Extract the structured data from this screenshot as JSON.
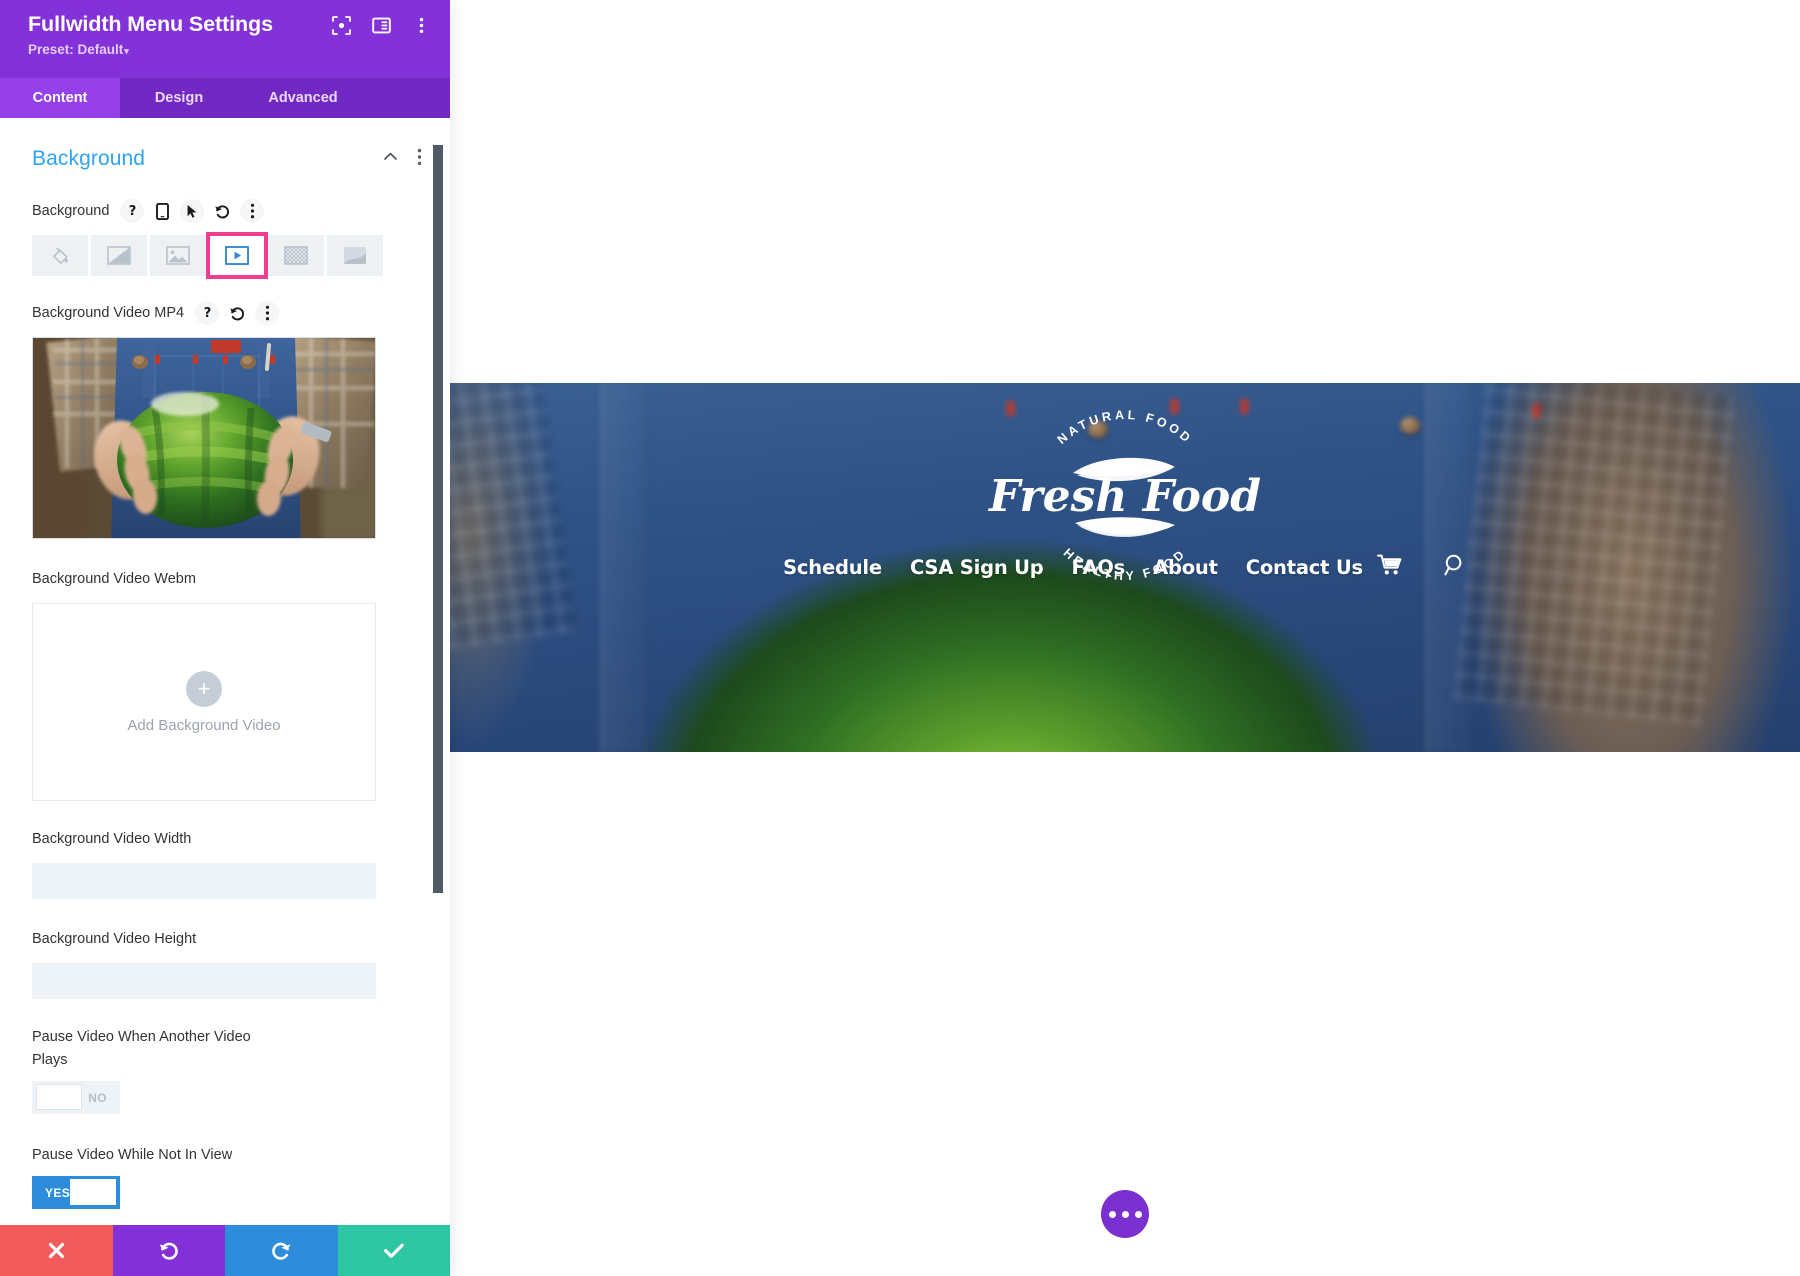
{
  "panel": {
    "title": "Fullwidth Menu Settings",
    "preset_label": "Preset: Default",
    "preset_caret": "▾",
    "header_icons": [
      {
        "name": "focus-icon"
      },
      {
        "name": "layout-toggle-icon"
      },
      {
        "name": "more-vertical-icon"
      }
    ],
    "tabs": [
      {
        "label": "Content",
        "active": true
      },
      {
        "label": "Design",
        "active": false
      },
      {
        "label": "Advanced",
        "active": false
      }
    ],
    "section": {
      "title": "Background",
      "collapse_icon": "chevron-up-icon",
      "more_icon": "more-vertical-icon"
    },
    "background_field": {
      "label": "Background",
      "icons": [
        "help-icon",
        "mobile-icon",
        "cursor-icon",
        "reset-icon",
        "more-vertical-icon"
      ],
      "types": [
        {
          "name": "background-color",
          "selected": false
        },
        {
          "name": "background-gradient",
          "selected": false
        },
        {
          "name": "background-image",
          "selected": false
        },
        {
          "name": "background-video",
          "selected": true
        },
        {
          "name": "background-pattern",
          "selected": false
        },
        {
          "name": "background-mask",
          "selected": false
        }
      ],
      "selected_highlight_color": "#ef3d8f"
    },
    "video_mp4": {
      "label": "Background Video MP4",
      "icons": [
        "help-icon",
        "reset-icon",
        "more-vertical-icon"
      ],
      "has_thumbnail": true
    },
    "video_webm": {
      "label": "Background Video Webm",
      "dropzone_text": "Add Background Video",
      "plus_glyph": "+"
    },
    "video_width": {
      "label": "Background Video Width",
      "value": "",
      "placeholder": ""
    },
    "video_height": {
      "label": "Background Video Height",
      "value": "",
      "placeholder": ""
    },
    "pause_other": {
      "label": "Pause Video When Another Video Plays",
      "state": "NO",
      "on": false
    },
    "pause_not_in_view": {
      "label": "Pause Video While Not In View",
      "state": "YES",
      "on": true
    },
    "actions": [
      {
        "name": "cancel-button",
        "icon": "close-icon",
        "color": "#f15b5b"
      },
      {
        "name": "undo-button",
        "icon": "undo-icon",
        "color": "#8330d8"
      },
      {
        "name": "redo-button",
        "icon": "redo-icon",
        "color": "#2d8ddb"
      },
      {
        "name": "save-button",
        "icon": "check-icon",
        "color": "#2ec6a2"
      }
    ]
  },
  "preview": {
    "logo": {
      "top_arc_text": "NATURAL FOOD",
      "script_text": "Fresh Food",
      "bottom_arc_text": "HEALTHY FOOD"
    },
    "nav": {
      "links": [
        "Schedule",
        "CSA Sign Up",
        "FAQs",
        "About",
        "Contact Us"
      ],
      "cart_icon": "shopping-cart-icon",
      "search_icon": "search-icon"
    },
    "fab": {
      "name": "page-settings-fab",
      "icon": "ellipsis-icon"
    }
  },
  "colors": {
    "panel_header": "#8331d8",
    "tab_active": "#9540e8",
    "tab_bar": "#7229c4",
    "section_title": "#2ea3f2",
    "highlight_pink": "#ef3d8f",
    "toggle_on": "#2d8ddb"
  }
}
